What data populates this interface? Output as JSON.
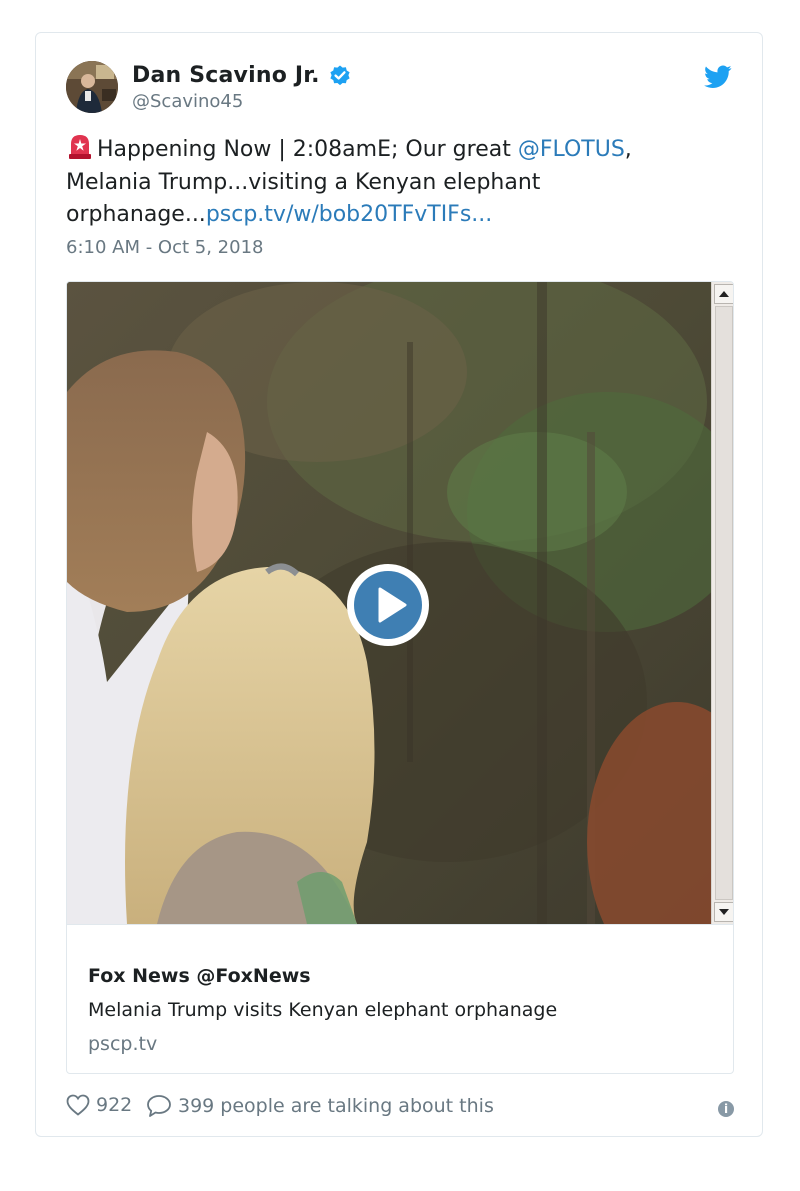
{
  "author": {
    "name": "Dan Scavino Jr.",
    "handle": "@Scavino45",
    "verified": true
  },
  "tweet": {
    "text_part1": "Happening Now | 2:08amE; Our great ",
    "mention": "@FLOTUS",
    "text_part2": ", Melania Trump...visiting a Kenyan elephant orphanage...",
    "link": "pscp.tv/w/bob20TFvTIFs...",
    "timestamp": "6:10 AM - Oct 5, 2018"
  },
  "media_card": {
    "author_line": "Fox News @FoxNews",
    "title": "Melania Trump visits Kenyan elephant orphanage",
    "domain": "pscp.tv"
  },
  "footer": {
    "likes": "922",
    "talking": "399 people are talking about this"
  },
  "colors": {
    "link": "#2b7bb9",
    "secondary_text": "#697882",
    "verified_badge": "#1da1f2",
    "twitter_bird": "#1da1f2",
    "play_button": "#3f7fb3"
  },
  "icons": {
    "verified": "verified-badge-icon",
    "bird": "twitter-bird-icon",
    "siren": "rotating-light-emoji-icon",
    "play": "play-icon",
    "like": "heart-icon",
    "comment": "speech-bubble-icon",
    "info": "info-icon"
  }
}
